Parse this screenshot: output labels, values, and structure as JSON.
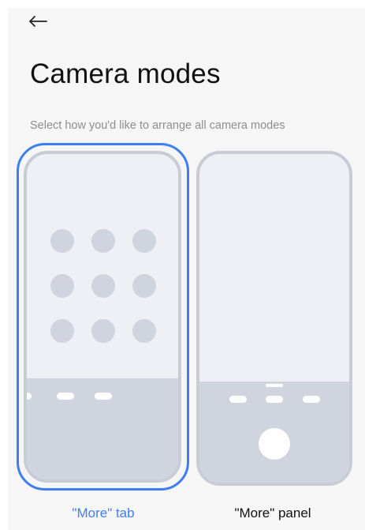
{
  "header": {
    "back_icon": "arrow-left-icon",
    "title": "Camera modes",
    "subtitle": "Select how you'd like to arrange all camera modes"
  },
  "options": [
    {
      "label": "\"More\" tab",
      "selected": true
    },
    {
      "label": "\"More\" panel",
      "selected": false
    }
  ],
  "colors": {
    "accent": "#3e7ef0",
    "background": "#f6f6f6",
    "phone_frame": "#c8ccd7",
    "phone_fill": "#eff0f5",
    "phone_bottom": "#d0d4de"
  }
}
